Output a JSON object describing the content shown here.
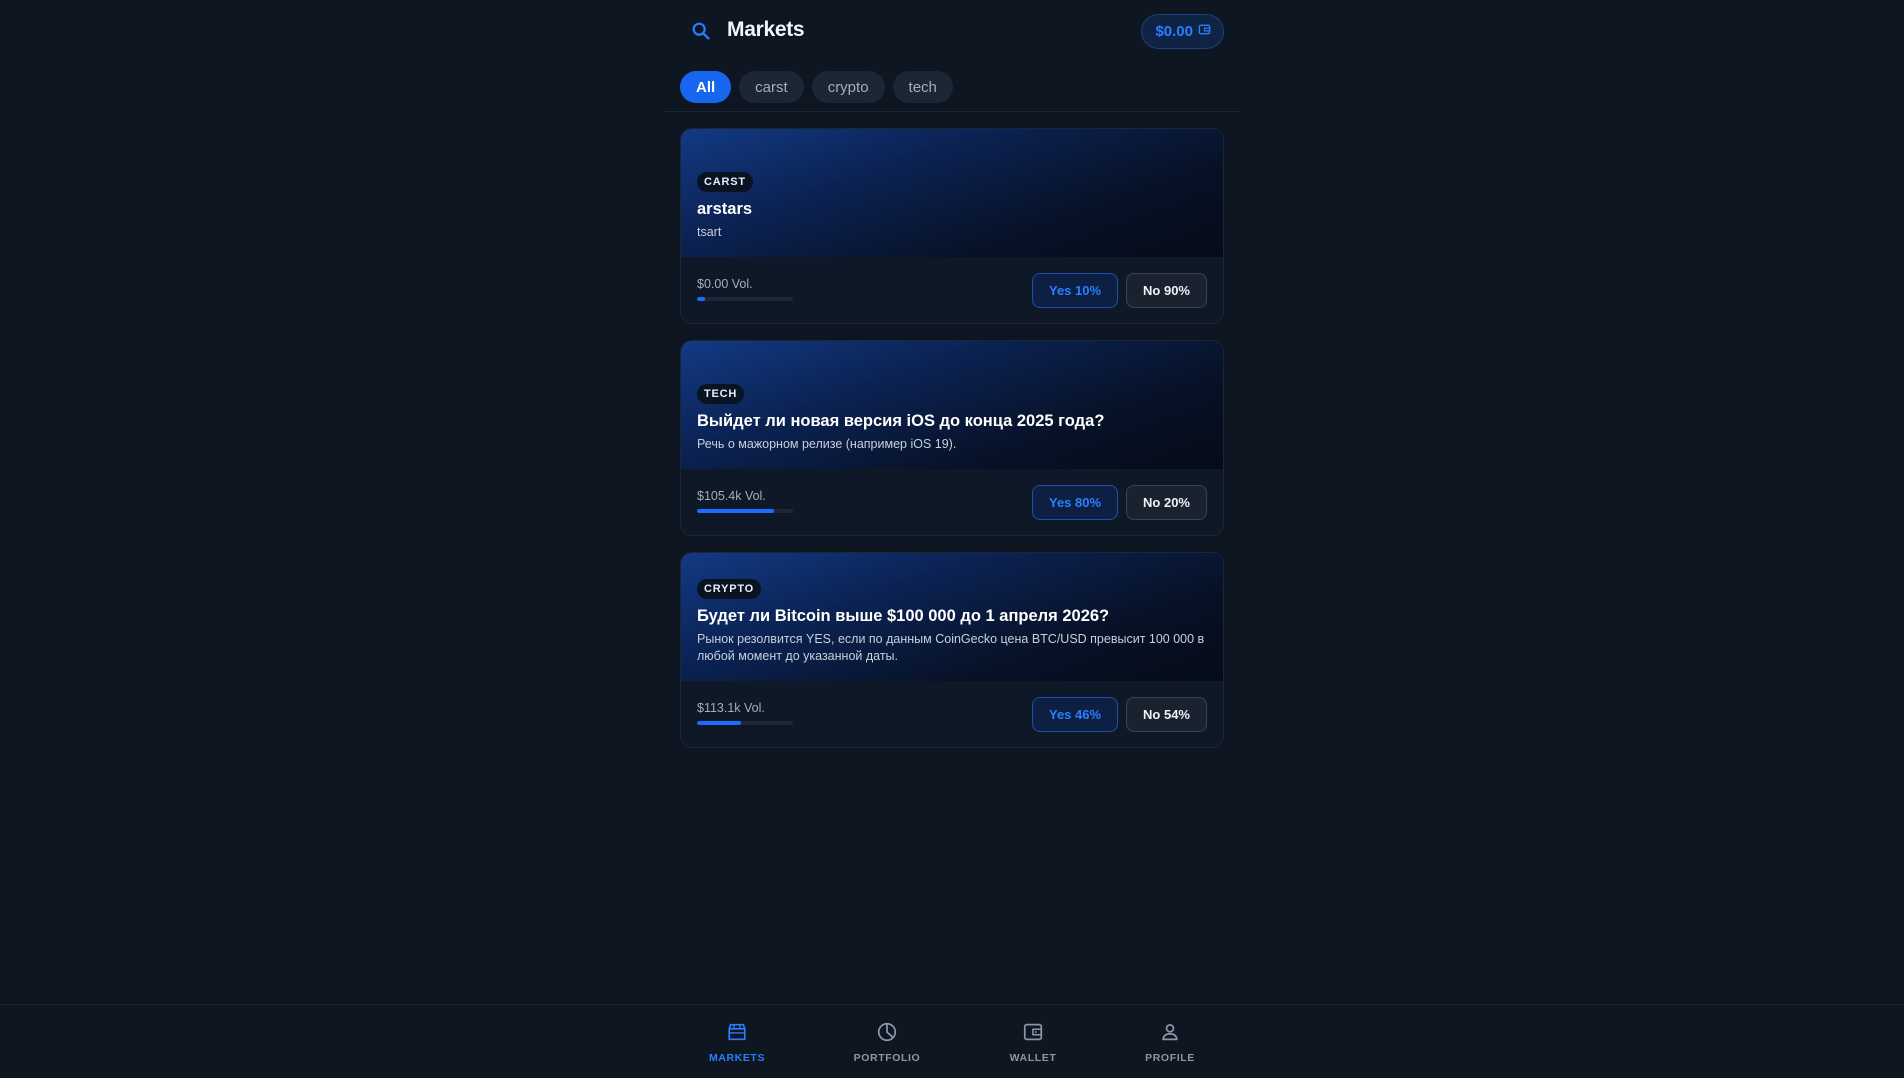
{
  "header": {
    "title": "Markets",
    "balance": "$0.00"
  },
  "filters": [
    "All",
    "carst",
    "crypto",
    "tech"
  ],
  "markets": [
    {
      "tag": "CARST",
      "title": "arstars",
      "description": "tsart",
      "volume": "$0.00 Vol.",
      "volume_fraction": 0.08,
      "yes": "Yes 10%",
      "no": "No 90%"
    },
    {
      "tag": "TECH",
      "title": "Выйдет ли новая версия iOS до конца 2025 года?",
      "description": "Речь о мажорном релизе (например iOS 19).",
      "volume": "$105.4k Vol.",
      "volume_fraction": 0.8,
      "yes": "Yes 80%",
      "no": "No 20%"
    },
    {
      "tag": "CRYPTO",
      "title": "Будет ли Bitcoin выше $100 000 до 1 апреля 2026?",
      "description": "Рынок резолвится YES, если по данным CoinGecko цена BTC/USD превысит 100 000 в любой момент до указанной даты.",
      "volume": "$113.1k Vol.",
      "volume_fraction": 0.46,
      "yes": "Yes 46%",
      "no": "No 54%"
    }
  ],
  "nav": [
    {
      "label": "MARKETS",
      "icon": "store-icon",
      "active": true
    },
    {
      "label": "PORTFOLIO",
      "icon": "pie-chart-icon",
      "active": false
    },
    {
      "label": "WALLET",
      "icon": "wallet-icon",
      "active": false
    },
    {
      "label": "PROFILE",
      "icon": "user-icon",
      "active": false
    }
  ],
  "colors": {
    "accent": "#1666f0",
    "background": "#0d1520",
    "card": "#0f1827"
  }
}
